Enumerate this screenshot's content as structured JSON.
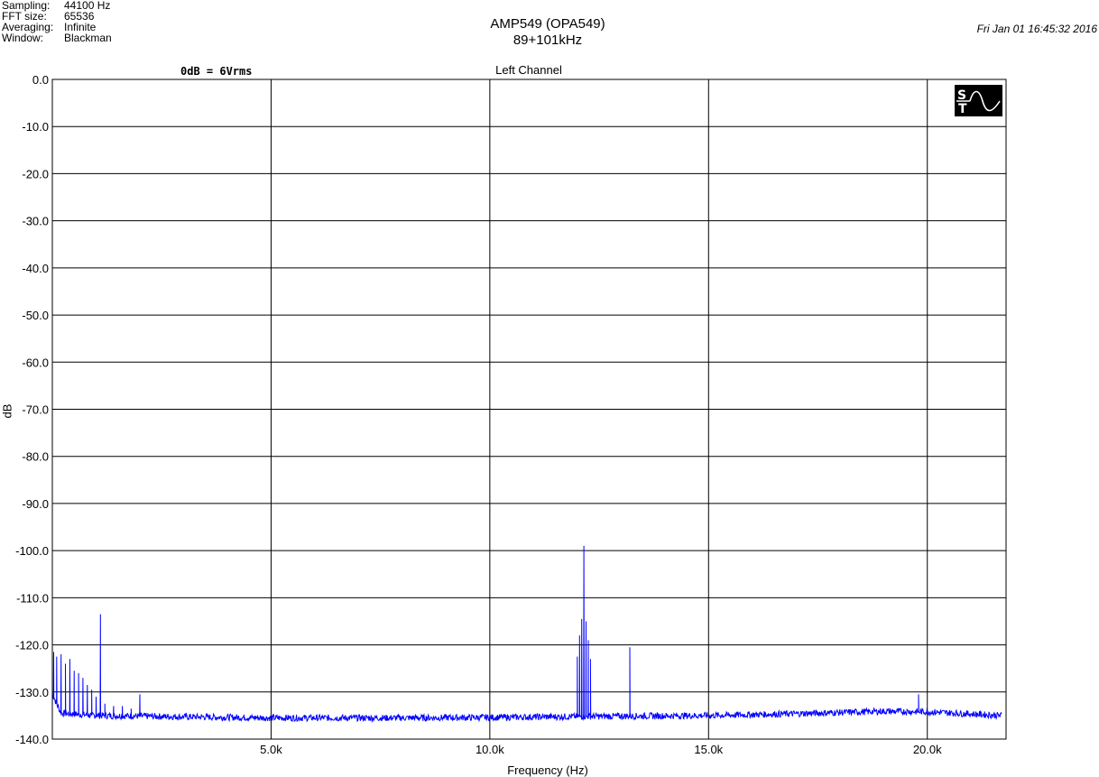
{
  "info": [
    {
      "key": "Sampling:",
      "value": "44100 Hz"
    },
    {
      "key": "FFT size:",
      "value": "65536"
    },
    {
      "key": "Averaging:",
      "value": "Infinite"
    },
    {
      "key": "Window:",
      "value": "Blackman"
    }
  ],
  "header": {
    "title": "AMP549 (OPA549)",
    "subtitle": "89+101kHz",
    "timestamp": "Fri Jan 01 16:45:32 2016",
    "reference": "0dB = 6Vrms",
    "channel": "Left Channel"
  },
  "logo": {
    "icon": "st-sine-logo-icon",
    "text": "ST"
  },
  "colors": {
    "trace": "#0000ff",
    "grid": "#000000",
    "background": "#ffffff"
  },
  "chart_data": {
    "type": "line",
    "title": "Left Channel",
    "xlabel": "Frequency (Hz)",
    "ylabel": "dB",
    "xlim": [
      0,
      21800
    ],
    "ylim": [
      -140,
      0
    ],
    "x_ticks": [
      5000,
      10000,
      15000,
      20000
    ],
    "x_tick_labels": [
      "5.0k",
      "10.0k",
      "15.0k",
      "20.0k"
    ],
    "y_ticks": [
      0,
      -10,
      -20,
      -30,
      -40,
      -50,
      -60,
      -70,
      -80,
      -90,
      -100,
      -110,
      -120,
      -130,
      -140
    ],
    "y_tick_labels": [
      "0.0",
      "-10.0",
      "-20.0",
      "-30.0",
      "-40.0",
      "-50.0",
      "-60.0",
      "-70.0",
      "-80.0",
      "-90.0",
      "-100.0",
      "-110.0",
      "-120.0",
      "-130.0",
      "-140.0"
    ],
    "grid": true,
    "series": [
      {
        "color": "#0000ff",
        "noise_floor": [
          {
            "x": 0,
            "y": -130.5
          },
          {
            "x": 200,
            "y": -134.5
          },
          {
            "x": 1000,
            "y": -135.0
          },
          {
            "x": 2500,
            "y": -135.2
          },
          {
            "x": 5000,
            "y": -135.5
          },
          {
            "x": 8000,
            "y": -135.5
          },
          {
            "x": 10000,
            "y": -135.4
          },
          {
            "x": 12000,
            "y": -135.2
          },
          {
            "x": 15000,
            "y": -135.0
          },
          {
            "x": 17000,
            "y": -134.6
          },
          {
            "x": 19000,
            "y": -134.1
          },
          {
            "x": 20000,
            "y": -134.2
          },
          {
            "x": 21700,
            "y": -135.0
          }
        ],
        "peaks": [
          {
            "x": 30,
            "y": -121.5
          },
          {
            "x": 100,
            "y": -122.5
          },
          {
            "x": 200,
            "y": -122.0
          },
          {
            "x": 300,
            "y": -124.0
          },
          {
            "x": 400,
            "y": -123.0
          },
          {
            "x": 500,
            "y": -125.5
          },
          {
            "x": 600,
            "y": -126.0
          },
          {
            "x": 700,
            "y": -127.0
          },
          {
            "x": 800,
            "y": -128.5
          },
          {
            "x": 900,
            "y": -129.5
          },
          {
            "x": 1000,
            "y": -131.0
          },
          {
            "x": 1100,
            "y": -113.5
          },
          {
            "x": 1200,
            "y": -132.5
          },
          {
            "x": 1400,
            "y": -133.0
          },
          {
            "x": 1600,
            "y": -133.0
          },
          {
            "x": 1800,
            "y": -133.5
          },
          {
            "x": 2000,
            "y": -130.5
          },
          {
            "x": 12000,
            "y": -122.5
          },
          {
            "x": 12050,
            "y": -118.0
          },
          {
            "x": 12100,
            "y": -114.5
          },
          {
            "x": 12150,
            "y": -99.0
          },
          {
            "x": 12200,
            "y": -115.0
          },
          {
            "x": 12250,
            "y": -119.0
          },
          {
            "x": 12300,
            "y": -123.0
          },
          {
            "x": 13200,
            "y": -120.5
          },
          {
            "x": 19800,
            "y": -130.5
          }
        ]
      }
    ]
  }
}
